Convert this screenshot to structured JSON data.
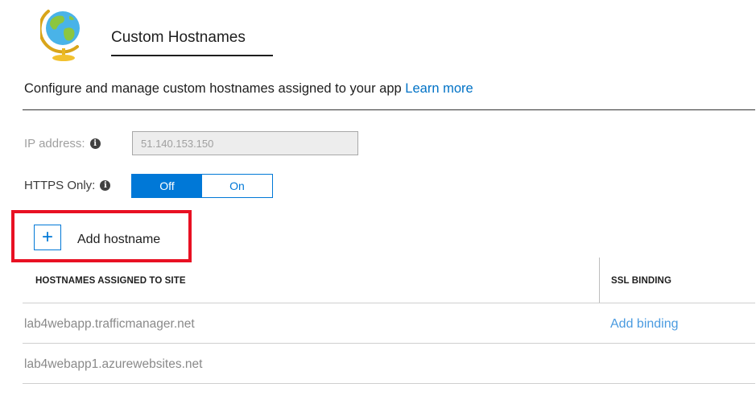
{
  "header": {
    "icon": "globe-icon",
    "title": "Custom Hostnames"
  },
  "description": {
    "text": "Configure and manage custom hostnames assigned to your app ",
    "link": "Learn more"
  },
  "ip_address": {
    "label": "IP address:",
    "value": "51.140.153.150"
  },
  "https_only": {
    "label": "HTTPS Only:",
    "options": [
      "Off",
      "On"
    ],
    "selected": "Off"
  },
  "add_hostname": {
    "label": "Add hostname",
    "icon": "plus-icon"
  },
  "table": {
    "columns": [
      "HOSTNAMES ASSIGNED TO SITE",
      "SSL BINDING"
    ],
    "rows": [
      {
        "hostname": "lab4webapp.trafficmanager.net",
        "ssl": "Add binding"
      },
      {
        "hostname": "lab4webapp1.azurewebsites.net",
        "ssl": ""
      }
    ]
  },
  "colors": {
    "accent": "#0078d7",
    "link": "#0072c6",
    "highlight": "#e81123"
  }
}
